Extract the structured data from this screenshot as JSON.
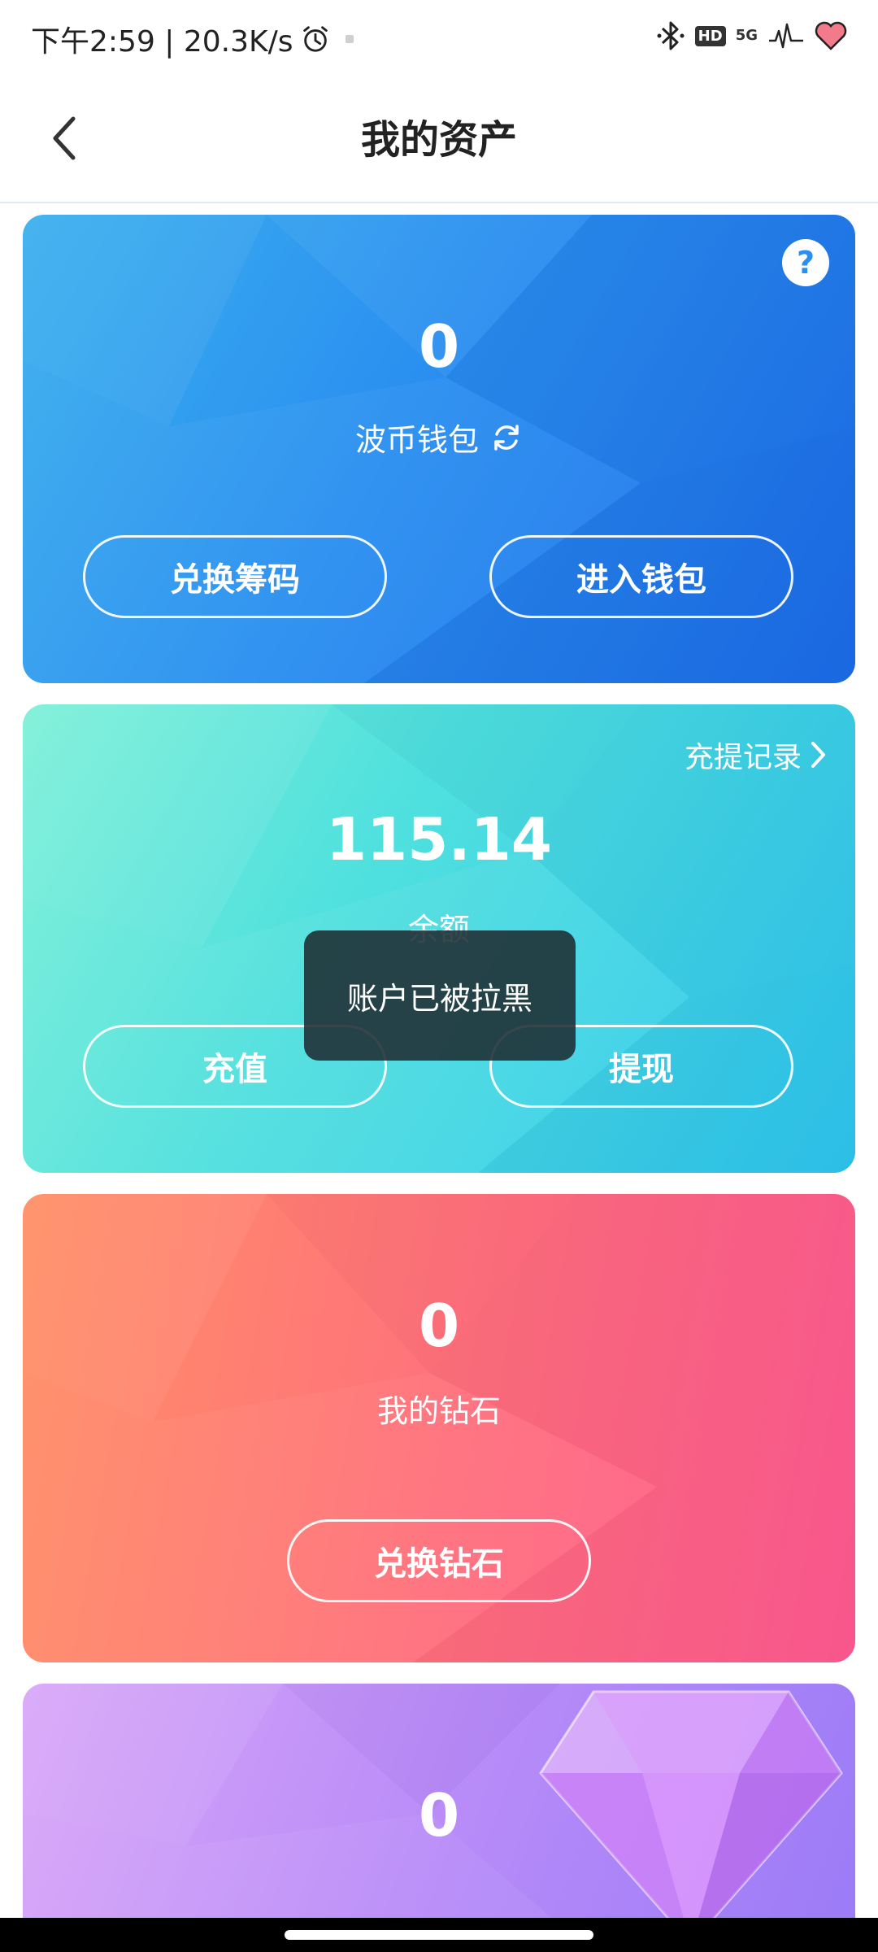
{
  "status_bar": {
    "time_speed": "下午2:59 | 20.3K/s",
    "hd_label": "HD",
    "network_label": "5G",
    "icons": [
      "alarm-icon",
      "bluetooth-icon",
      "signal-icon",
      "heart-rate-icon"
    ]
  },
  "header": {
    "title": "我的资产",
    "back_icon": "chevron-left-icon"
  },
  "wallet_card": {
    "amount": "0",
    "label": "波币钱包",
    "refresh_icon": "refresh-icon",
    "help_glyph": "?",
    "exchange_button": "兑换筹码",
    "enter_wallet_button": "进入钱包",
    "accent": "#1d70ec"
  },
  "balance_card": {
    "records_link": "充提记录",
    "amount": "115.14",
    "label": "余额",
    "recharge_button": "充值",
    "withdraw_button": "提现",
    "accent": "#2fc6ee"
  },
  "diamond_card": {
    "amount": "0",
    "label": "我的钻石",
    "exchange_button": "兑换钻石",
    "accent": "#ff5b92"
  },
  "purple_card": {
    "amount": "0",
    "gem_icon": "gem-icon",
    "accent": "#9b7bf7"
  },
  "toast": {
    "message": "账户已被拉黑"
  }
}
